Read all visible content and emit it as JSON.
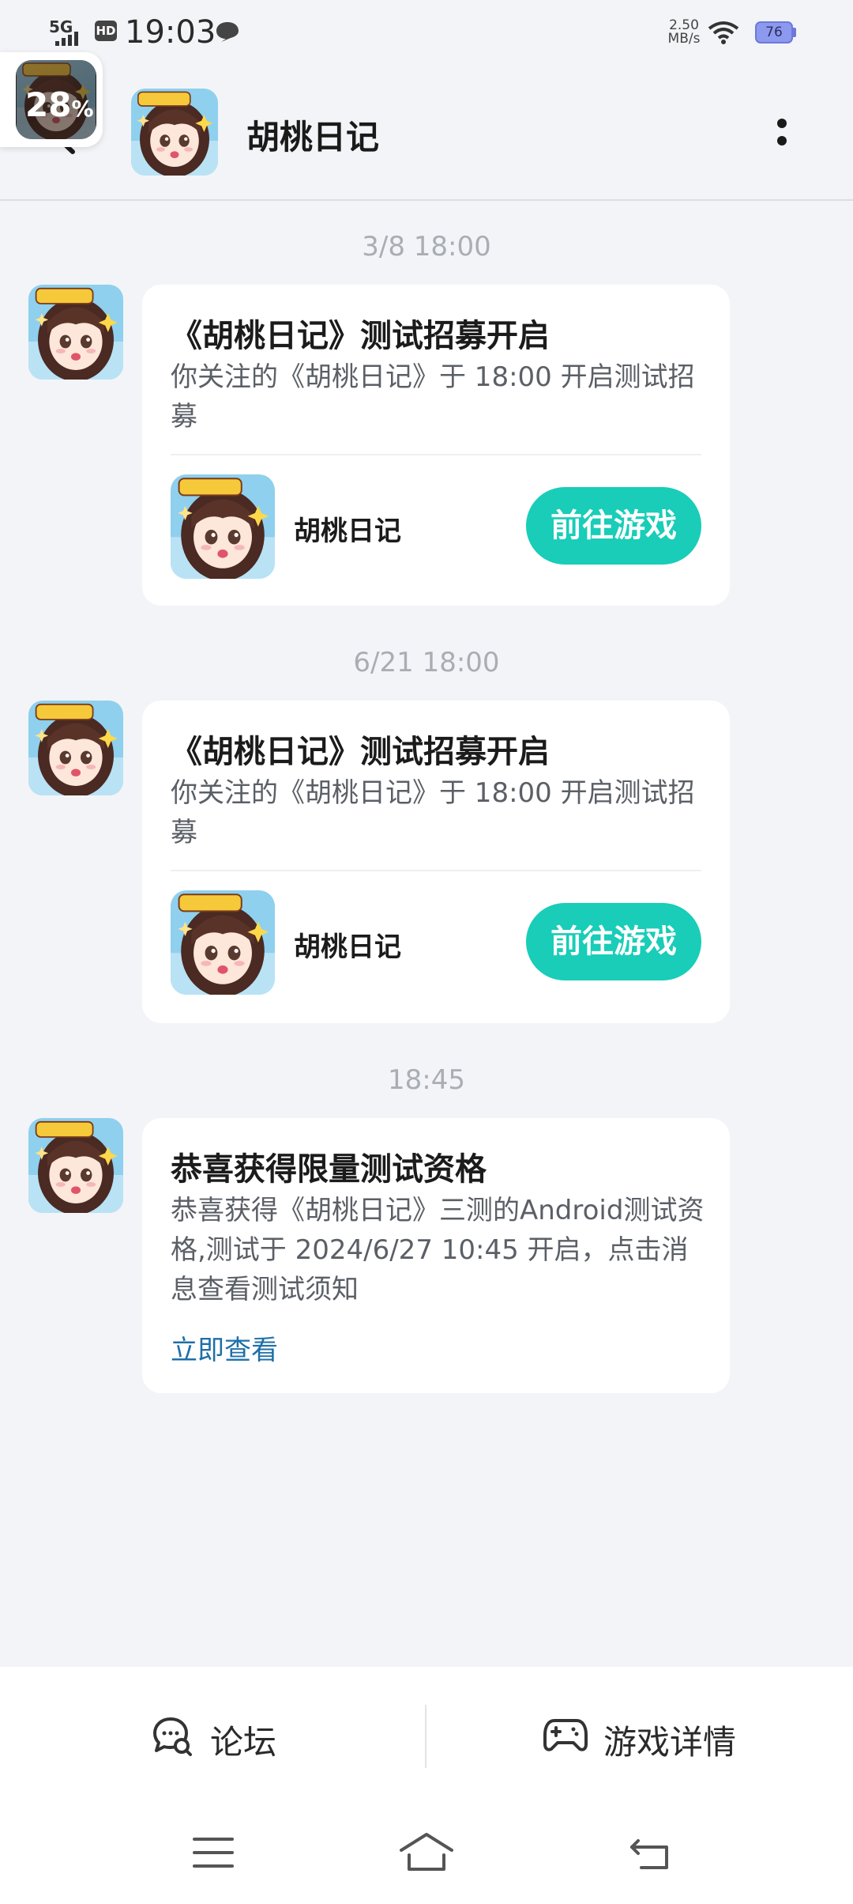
{
  "status_bar": {
    "signal_label": "5G",
    "hd_label": "HD",
    "time": "19:03",
    "net_speed_value": "2.50",
    "net_speed_unit": "MB/s",
    "battery_level": "76"
  },
  "floating_widget": {
    "percent": "28",
    "percent_sign": "%"
  },
  "header": {
    "title": "胡桃日记"
  },
  "messages": [
    {
      "timestamp": "3/8  18:00",
      "title": "《胡桃日记》测试招募开启",
      "body": "你关注的《胡桃日记》于 18:00 开启测试招募",
      "game_name": "胡桃日记",
      "button_label": "前往游戏"
    },
    {
      "timestamp": "6/21  18:00",
      "title": "《胡桃日记》测试招募开启",
      "body": "你关注的《胡桃日记》于 18:00 开启测试招募",
      "game_name": "胡桃日记",
      "button_label": "前往游戏"
    },
    {
      "timestamp": "18:45",
      "title": "恭喜获得限量测试资格",
      "body": "恭喜获得《胡桃日记》三测的Android测试资格,测试于 2024/6/27 10:45 开启，点击消息查看测试须知",
      "link_label": "立即查看"
    }
  ],
  "bottom_bar": {
    "forum_label": "论坛",
    "game_details_label": "游戏详情"
  },
  "colors": {
    "accent": "#19cdb8",
    "link": "#1f6fa8",
    "background": "#f3f4f7"
  },
  "icons": [
    "back-arrow-icon",
    "more-icon",
    "forum-icon",
    "gamepad-icon",
    "menu-icon",
    "home-icon",
    "back-icon",
    "wifi-icon",
    "message-icon"
  ]
}
